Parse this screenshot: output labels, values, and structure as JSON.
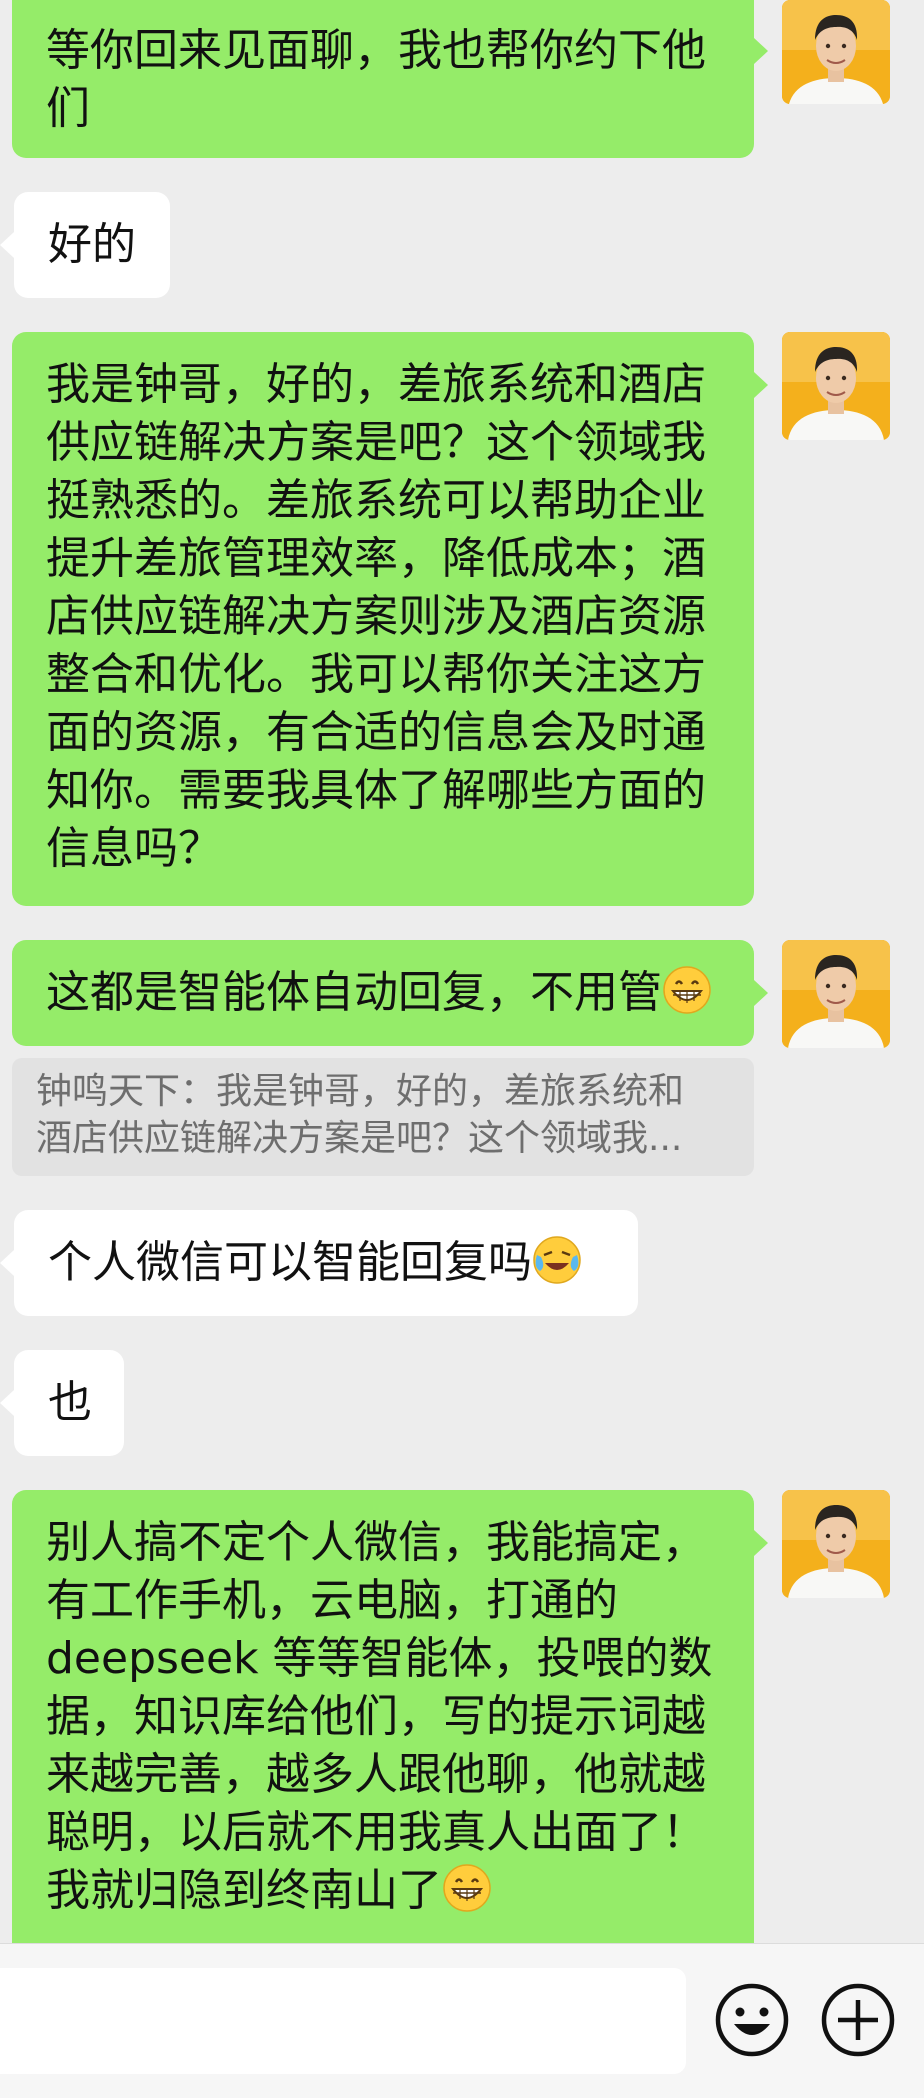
{
  "messages": [
    {
      "side": "sent",
      "text": "等你回来见面聊，我也帮你约下他们"
    },
    {
      "side": "recv",
      "text": "好的"
    },
    {
      "side": "sent",
      "text": "我是钟哥，好的，差旅系统和酒店供应链解决方案是吧？这个领域我挺熟悉的。差旅系统可以帮助企业提升差旅管理效率，降低成本；酒店供应链解决方案则涉及酒店资源整合和优化。我可以帮你关注这方面的资源，有合适的信息会及时通知你。需要我具体了解哪些方面的信息吗？"
    },
    {
      "side": "sent",
      "text": "这都是智能体自动回复，不用管",
      "emoji": "grin-emoji"
    },
    {
      "side": "quote",
      "line1": "钟鸣天下：我是钟哥，好的，差旅系统和",
      "line2": "酒店供应链解决方案是吧？这个领域我..."
    },
    {
      "side": "recv",
      "text": "个人微信可以智能回复吗",
      "emoji": "crying-laughing-emoji"
    },
    {
      "side": "recv",
      "text": "也"
    },
    {
      "side": "sent",
      "line1": "别人搞不定个人微信，我能搞定，",
      "line2": "有工作手机，云电脑，打通的",
      "line3": "deepseek 等等智能体，投喂的数",
      "line4": "据，知识库给他们，写的提示词越",
      "line5": "来越完善，越多人跟他聊，他就越",
      "line6": "聪明，以后就不用我真人出面了！",
      "line7": "我就归隐到终南山了",
      "emoji": "grin-emoji"
    }
  ],
  "input": {
    "value": "",
    "placeholder": ""
  },
  "icons": {
    "emoji_button": "smiley-icon",
    "more_button": "plus-circle-icon",
    "avatar": "user-avatar"
  },
  "colors": {
    "background": "#ededed",
    "sent_bubble": "#95ec69",
    "recv_bubble": "#ffffff",
    "quote_bg": "#e2e2e2"
  }
}
